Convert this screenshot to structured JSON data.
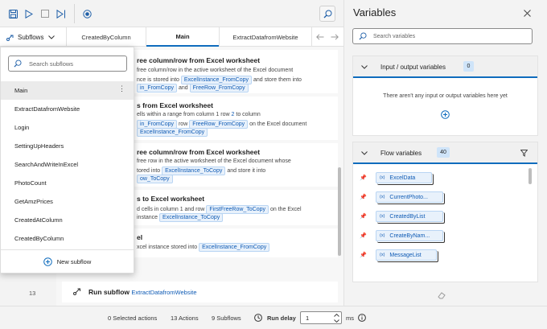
{
  "toolbar": {
    "icons": [
      "save-icon",
      "run-icon",
      "stop-icon",
      "run-next-icon",
      "record-icon",
      "search-icon"
    ]
  },
  "tabs": {
    "subflows_label": "Subflows",
    "items": [
      "CreatedByColumn",
      "Main",
      "ExtractDatafromWebsite"
    ],
    "active": "Main"
  },
  "dropdown": {
    "search_placeholder": "Search subflows",
    "items": [
      "Main",
      "ExtractDatafromWebsite",
      "Login",
      "SettingUpHeaders",
      "SearchAndWriteInExcel",
      "PhotoCount",
      "GetAmzPrices",
      "CreatedAtColumn",
      "CreatedByColumn"
    ],
    "new_label": "New subflow"
  },
  "actions": [
    {
      "title": "ree column/row from Excel worksheet",
      "line1": "free column/row in the active worksheet of the Excel document",
      "line2_pre": "nce is stored into",
      "line2_tag": "ExcelInstance_FromCopy",
      "line2_post": "and store them into",
      "line3_tag1": "in_FromCopy",
      "line3_mid": "and",
      "line3_tag2": "FreeRow_FromCopy"
    },
    {
      "title": "s from Excel worksheet",
      "line1_pre": "ells within a range from column 1 row",
      "line1_num": "2",
      "line1_post": "to column",
      "line2_tag1": "in_FromCopy",
      "line2_mid": "row",
      "line2_tag2": "FreeRow_FromCopy",
      "line2_post": "on the Excel document",
      "line3_tag": "ExcelInstance_FromCopy"
    },
    {
      "title": "ree column/row from Excel worksheet",
      "line1": "free row in the active worksheet of the Excel document whose",
      "line2_pre": "tored into",
      "line2_tag": "ExcelInstance_ToCopy",
      "line2_post": "and store it into",
      "line3_tag": "ow_ToCopy"
    },
    {
      "title": "s to Excel worksheet",
      "line1_pre": "d cells in column 1 and row",
      "line1_tag": "FirstFreeRow_ToCopy",
      "line1_post": "on the Excel",
      "line2_pre": "instance",
      "line2_tag": "ExcelInstance_ToCopy"
    },
    {
      "title": "el",
      "line1_pre": "xcel instance stored into",
      "line1_tag": "ExcelInstance_FromCopy"
    }
  ],
  "run_subflow": {
    "line_number": "13",
    "label": "Run subflow",
    "target": "ExtractDatafromWebsite"
  },
  "footer": {
    "selected": "0 Selected actions",
    "actions": "13 Actions",
    "subflows": "9 Subflows",
    "run_delay_label": "Run delay",
    "run_delay_value": "1",
    "unit": "ms"
  },
  "variables": {
    "title": "Variables",
    "search_placeholder": "Search variables",
    "io": {
      "label": "Input / output variables",
      "count": "0",
      "empty_text": "There aren't any input or output variables here yet"
    },
    "flow": {
      "label": "Flow variables",
      "count": "40",
      "items": [
        "ExcelData",
        "CurrentPhoto...",
        "CreatedByList",
        "CreateByNam...",
        "MessageList"
      ]
    }
  },
  "colors": {
    "accent": "#0f6cbd",
    "tag_bg": "#e8f1fb",
    "tag_text": "#0f5bb5"
  }
}
